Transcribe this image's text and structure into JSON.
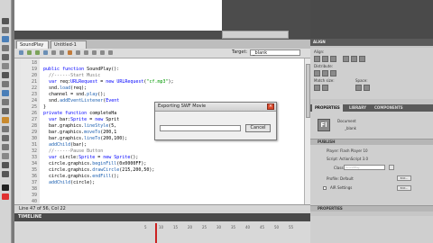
{
  "document_tabs": [
    "SoundPlay",
    "Untitled-1"
  ],
  "script_toolbar": {
    "target_label": "Target:",
    "target_value": "_blank"
  },
  "gutter": {
    "line_numbers": [
      "18",
      "19",
      "20",
      "21",
      "22",
      "23",
      "24",
      "25",
      "26",
      "27",
      "28",
      "29",
      "30",
      "31",
      "32",
      "33",
      "34",
      "35",
      "36",
      "37",
      "38",
      "39",
      "40"
    ]
  },
  "code": {
    "lines": [
      "",
      "public function SoundPlay():",
      "  //------Start Music",
      "  var req:URLRequest = new URLRequest(\"cf.mp3\");",
      "  snd.load(req);",
      "  channel = snd.play();",
      "  snd.addEventListener(Event",
      "}",
      "private function completeHa",
      "  var bar:Sprite = new Sprit",
      "  bar.graphics.lineStyle(5,",
      "  bar.graphics.moveTo(200,1",
      "  bar.graphics.lineTo(200,100);",
      "  addChild(bar);",
      "  //------Pause Button",
      "  var circle:Sprite = new Sprite();",
      "  circle.graphics.beginFill(0x0000FF);",
      "  circle.graphics.drawCircle(215,200,50);",
      "  circle.graphics.endFill();",
      "  addChild(circle);",
      "",
      "",
      ""
    ]
  },
  "status_bar": {
    "text": "Line 47 of 56, Col 22"
  },
  "timeline": {
    "title": "TIMELINE",
    "ticks": [
      "5",
      "10",
      "15",
      "20",
      "25",
      "30",
      "35",
      "40",
      "45",
      "50",
      "55"
    ]
  },
  "dialog": {
    "title": "Exporting SWF Movie",
    "cancel_label": "Cancel",
    "input_value": ""
  },
  "right_panel": {
    "align_header": "ALIGN",
    "align_labels": [
      "Align:",
      "Distribute:",
      "Match size:",
      "Space:"
    ],
    "tabs": [
      "PROPERTIES",
      "LIBRARY",
      "COMPONENTS"
    ],
    "document_type": "Document",
    "document_name": "_blank",
    "publish_header": "PUBLISH",
    "player_label": "Player: Flash Player 10",
    "script_label": "Script: ActionScript 3.0",
    "class_label": "Class:",
    "class_placeholder": "SoundPlay",
    "profile_label": "Profile: Default",
    "edit_label": "Edit...",
    "air_label": "AIR Settings",
    "properties_header": "PROPERTIES"
  }
}
